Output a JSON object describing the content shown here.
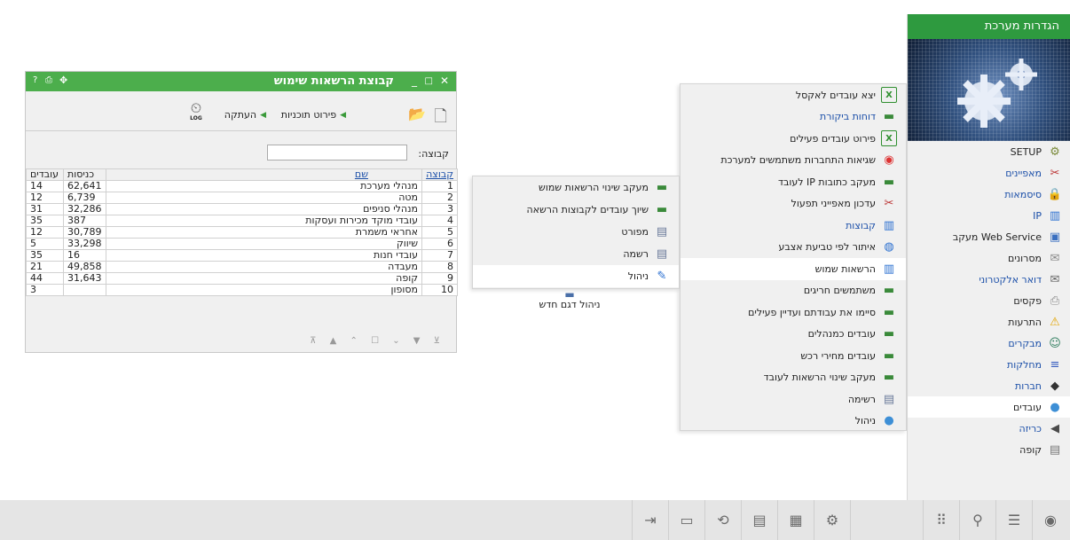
{
  "system_menu": {
    "title": "הגדרות מערכת",
    "items": [
      {
        "label": "SETUP",
        "icon": "setup-icon",
        "link": false
      },
      {
        "label": "מאפיינים",
        "icon": "tools-icon",
        "link": true
      },
      {
        "label": "סיסמאות",
        "icon": "lock-icon",
        "link": true
      },
      {
        "label": "IP",
        "icon": "books-icon",
        "link": true
      },
      {
        "label": "מעקב Web Service",
        "icon": "web-service-icon",
        "link": false
      },
      {
        "label": "מסרונים",
        "icon": "sms-icon",
        "link": false
      },
      {
        "label": "דואר אלקטרוני",
        "icon": "email-icon",
        "link": true
      },
      {
        "label": "פקסים",
        "icon": "fax-icon",
        "link": false
      },
      {
        "label": "התרעות",
        "icon": "warning-icon",
        "link": false
      },
      {
        "label": "מבקרים",
        "icon": "visitor-icon",
        "link": true
      },
      {
        "label": "מחלקות",
        "icon": "departments-icon",
        "link": true
      },
      {
        "label": "חברות",
        "icon": "companies-icon",
        "link": true
      },
      {
        "label": "עובדים",
        "icon": "employees-icon",
        "link": false,
        "selected": true
      },
      {
        "label": "כריזה",
        "icon": "speaker-icon",
        "link": true
      },
      {
        "label": "קופה",
        "icon": "register-icon",
        "link": false
      }
    ]
  },
  "submenu": {
    "items": [
      {
        "label": "יצא עובדים לאקסל",
        "icon": "excel-icon",
        "link": false
      },
      {
        "label": "דוחות ביקורת",
        "icon": "report-icon",
        "link": true
      },
      {
        "label": "פירוט עובדים פעילים",
        "icon": "excel-icon",
        "link": false
      },
      {
        "label": "שגיאות התחברות משתמשים למערכת",
        "icon": "error-icon",
        "link": false
      },
      {
        "label": "מעקב כתובות IP לעובד",
        "icon": "report-icon",
        "link": false
      },
      {
        "label": "עדכון מאפייני תפעול",
        "icon": "tools-icon",
        "link": false
      },
      {
        "label": "קבוצות",
        "icon": "books-icon",
        "link": true
      },
      {
        "label": "איתור לפי טביעת אצבע",
        "icon": "fingerprint-icon",
        "link": false
      },
      {
        "label": "הרשאות שמוש",
        "icon": "books-icon",
        "link": false,
        "selected": true
      },
      {
        "label": "משתמשים חריגים",
        "icon": "report-icon",
        "link": false
      },
      {
        "label": "סיימו את עבודתם ועדיין פעילים",
        "icon": "report-icon",
        "link": false
      },
      {
        "label": "עובדים כמנהלים",
        "icon": "report-icon",
        "link": false
      },
      {
        "label": "עובדים מחירי רכש",
        "icon": "report-icon",
        "link": false
      },
      {
        "label": "מעקב שינוי הרשאות לעובד",
        "icon": "report-icon",
        "link": false
      },
      {
        "label": "רשימה",
        "icon": "list-icon",
        "link": false
      },
      {
        "label": "ניהול",
        "icon": "employees-icon",
        "link": false
      }
    ]
  },
  "submenu3": {
    "items": [
      {
        "label": "מעקב שינוי הרשאות שמוש",
        "icon": "report-icon"
      },
      {
        "label": "שיוך עובדים לקבוצות הרשאה",
        "icon": "report-icon"
      },
      {
        "label": "מפורט",
        "icon": "list-icon"
      },
      {
        "label": "רשמה",
        "icon": "list-icon"
      },
      {
        "label": "ניהול",
        "icon": "manage-icon",
        "selected": true
      }
    ]
  },
  "desktop_item": {
    "label": "ניהול דגם חדש",
    "icon": "monitor-icon"
  },
  "window": {
    "title": "קבוצת הרשאות שימוש",
    "toolbar": {
      "detail_label": "פירוט תוכניות",
      "copy_label": "העתקה",
      "log_label": "LOG"
    },
    "filter_label": "קבוצה:",
    "filter_value": "",
    "columns": [
      "קבוצה",
      "שם",
      "כניסות",
      "עובדים"
    ],
    "rows": [
      {
        "group": "1",
        "name": "מנהלי מערכת",
        "entries": "62,641",
        "employees": "14"
      },
      {
        "group": "2",
        "name": "מטה",
        "entries": "6,739",
        "employees": "12"
      },
      {
        "group": "3",
        "name": "מנהלי סניפים",
        "entries": "32,286",
        "employees": "31"
      },
      {
        "group": "4",
        "name": "עובדי מוקד מכירות ועסקות",
        "entries": "387",
        "employees": "35"
      },
      {
        "group": "5",
        "name": "אחראי משמרת",
        "entries": "30,789",
        "employees": "12"
      },
      {
        "group": "6",
        "name": "שיווק",
        "entries": "33,298",
        "employees": "5"
      },
      {
        "group": "7",
        "name": "עובדי חנות",
        "entries": "16",
        "employees": "35"
      },
      {
        "group": "8",
        "name": "מעבדה",
        "entries": "49,858",
        "employees": "21"
      },
      {
        "group": "9",
        "name": "קופה",
        "entries": "31,643",
        "employees": "44"
      },
      {
        "group": "10",
        "name": "מסופון",
        "entries": "",
        "employees": "3"
      }
    ]
  },
  "taskbar": {
    "buttons": [
      "logout-icon",
      "monitor-icon",
      "refresh-icon",
      "chat-icon",
      "chip-icon",
      "gear-icon",
      "apps-grid-icon",
      "search-icon",
      "list-icon",
      "home-icon"
    ]
  },
  "colors": {
    "accent_green": "#2e9a3f",
    "window_green": "#4cae4c",
    "link_blue": "#1a4ea8"
  }
}
